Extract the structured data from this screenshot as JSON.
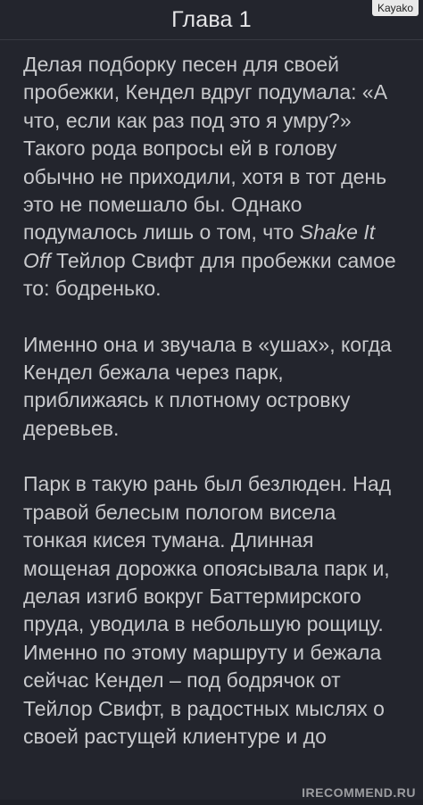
{
  "header": {
    "chapter_title": "Глава 1"
  },
  "watermark_top": "Kayako",
  "paragraphs": [
    {
      "before": "Делая подборку песен для своей пробежки, Кендел вдруг подумала: «А что, если как раз под это я умру?» Такого рода вопросы ей в голову обычно не приходили, хотя в тот день это не помешало бы. Однако подумалось лишь о том, что ",
      "italic": "Shake It Off",
      "after": " Тейлор Свифт для пробежки самое то: бодренько."
    },
    {
      "before": "Именно она и звучала в «ушах», когда Кендел бежала через парк, приближаясь к плотному островку деревьев.",
      "italic": "",
      "after": ""
    },
    {
      "before": "Парк в такую рань был безлюден. Над травой белесым пологом висела тонкая кисея тумана. Длинная мощеная дорожка опоясывала парк и, делая изгиб вокруг Баттермирского пруда, уводила в небольшую рощицу. Именно по этому маршруту и бежала сейчас Кендел – под бодрячок от Тейлор Свифт, в радостных мыслях о своей растущей клиентуре и до",
      "italic": "",
      "after": ""
    }
  ],
  "watermark_bottom": "IRECOMMEND.RU",
  "colors": {
    "background": "#23252d",
    "text": "#c8c9cc",
    "title": "#e6e6e8"
  }
}
